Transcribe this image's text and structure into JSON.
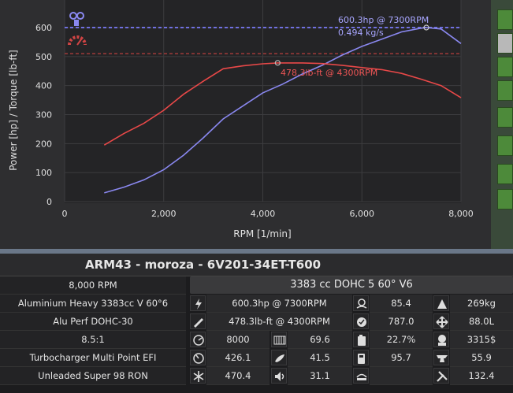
{
  "chart": {
    "y_axis_label": "Power [hp] / Torque [lb-ft]",
    "x_axis_label": "RPM [1/min]",
    "y_ticks": [
      "0",
      "100",
      "200",
      "300",
      "400",
      "500",
      "600"
    ],
    "x_ticks": [
      "0",
      "2,000",
      "4,000",
      "6,000",
      "8,000"
    ],
    "power_label_line1": "600.3hp @ 7300RPM",
    "power_label_line2": "0.494 kg/s",
    "torque_label": "478.3lb-ft @ 4300RPM",
    "colors": {
      "power": "#8a88f0",
      "torque": "#e84848",
      "grid": "#3c3c3f",
      "bg": "#242426"
    }
  },
  "chart_data": {
    "type": "line",
    "xlabel": "RPM [1/min]",
    "ylabel": "Power [hp] / Torque [lb-ft]",
    "xlim": [
      0,
      8000
    ],
    "ylim": [
      0,
      650
    ],
    "series": [
      {
        "x": [
          800,
          1200,
          1600,
          2000,
          2400,
          2800,
          3200,
          3600,
          4000,
          4400,
          4800,
          5200,
          5600,
          6000,
          6400,
          6800,
          7200,
          7300,
          7600,
          8000
        ],
        "values": [
          30,
          50,
          75,
          110,
          160,
          220,
          285,
          330,
          375,
          405,
          440,
          470,
          505,
          535,
          560,
          585,
          598,
          600,
          595,
          545
        ]
      },
      {
        "x": [
          800,
          1200,
          1600,
          2000,
          2400,
          2800,
          3200,
          3600,
          4000,
          4300,
          4800,
          5200,
          5600,
          6000,
          6400,
          6800,
          7200,
          7600,
          8000
        ],
        "values": [
          195,
          235,
          270,
          315,
          370,
          415,
          458,
          468,
          475,
          478,
          478,
          476,
          470,
          462,
          455,
          442,
          422,
          400,
          358
        ]
      }
    ],
    "reference_lines": [
      600,
      510
    ]
  },
  "title": "ARM43 - moroza - 6V201-34ET-T600",
  "header_left": "8,000 RPM",
  "header_right": "3383 cc DOHC 5 60° V6",
  "left_rows": [
    "Aluminium Heavy 3383cc V 60°6",
    "Alu Perf DOHC-30",
    "8.5:1",
    "Turbocharger Multi Point EFI",
    "Unleaded Super 98 RON"
  ],
  "stats": [
    [
      "600.3hp @ 7300RPM",
      "85.4",
      "269kg"
    ],
    [
      "478.3lb-ft @ 4300RPM",
      "787.0",
      "88.0L"
    ],
    [
      "8000",
      "69.6",
      "22.7%",
      "3315$"
    ],
    [
      "426.1",
      "41.5",
      "95.7",
      "55.9"
    ],
    [
      "470.4",
      "31.1",
      "",
      "132.4"
    ]
  ],
  "icons": [
    "power-icon",
    "exhaust-icon",
    "weight-icon",
    "torque-icon",
    "reliability-icon",
    "dimensions-icon",
    "rpm-gauge-icon",
    "radiator-icon",
    "fuel-can-icon",
    "cost-icon",
    "turbo-gauge-icon",
    "emissions-icon",
    "octane-icon",
    "anvil-icon",
    "cooling-icon",
    "noise-icon",
    "service-icon",
    "tools-icon"
  ]
}
